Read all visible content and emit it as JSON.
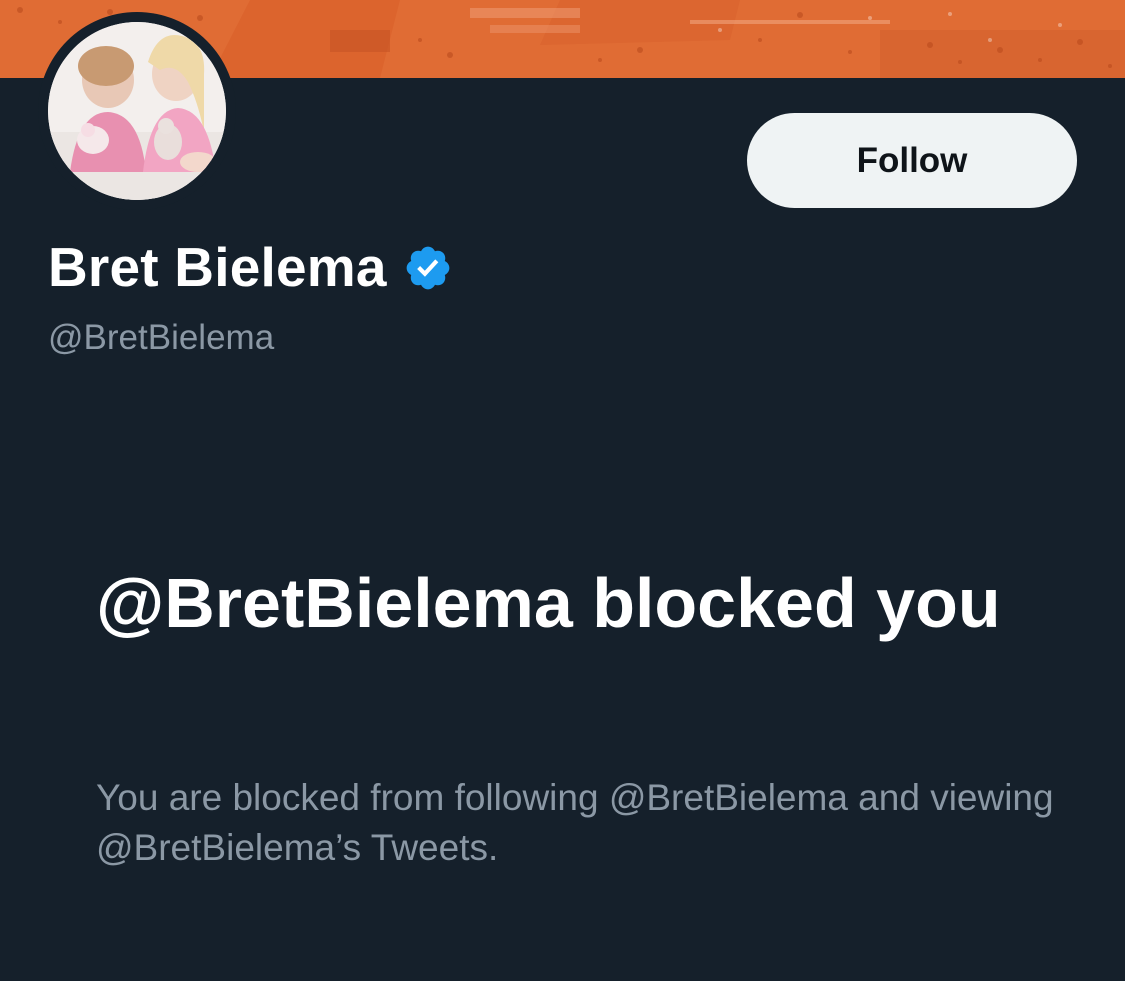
{
  "profile": {
    "display_name": "Bret Bielema",
    "handle": "@BretBielema",
    "verified": true,
    "follow_label": "Follow"
  },
  "blocked_notice": {
    "title": "@BretBielema blocked you",
    "description": "You are blocked from following @BretBielema and viewing @BretBielema’s Tweets."
  },
  "icons": {
    "verified": "verified-badge-icon",
    "avatar": "profile-photo",
    "banner": "header-banner-image"
  },
  "colors": {
    "background": "#15202b",
    "banner_orange": "#e2703a",
    "verified_blue": "#1d9bf0",
    "secondary_text": "#8b98a5",
    "follow_button_bg": "#eff3f4"
  }
}
